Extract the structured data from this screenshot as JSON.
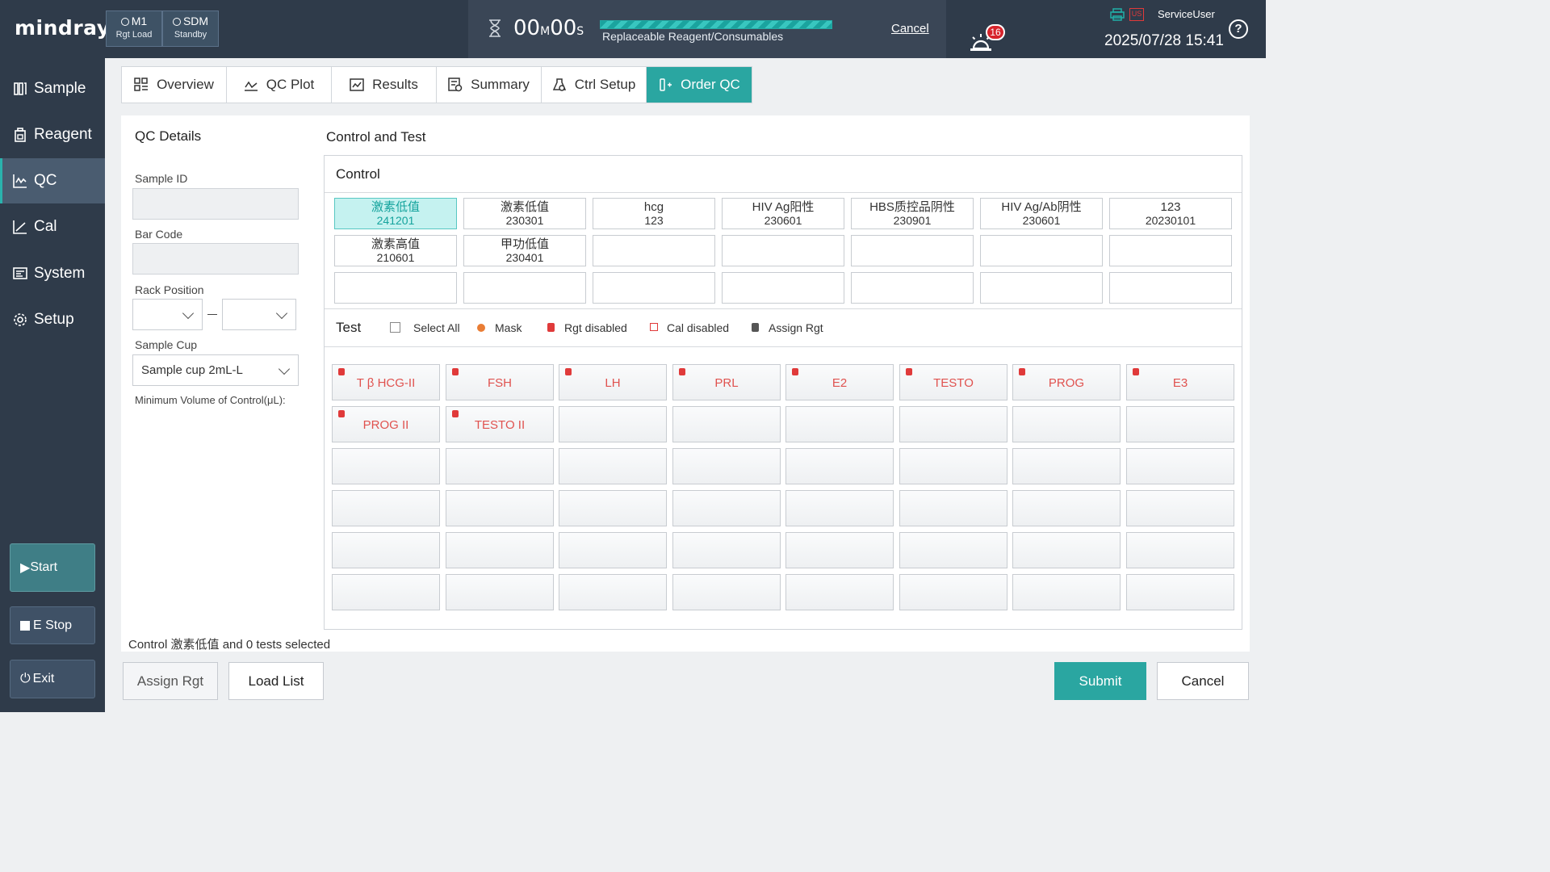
{
  "header": {
    "logo": "mindray",
    "modules": [
      {
        "name": "M1",
        "status": "Rgt Load"
      },
      {
        "name": "SDM",
        "status": "Standby"
      }
    ],
    "timer_min": "00",
    "timer_min_unit": "M",
    "timer_sec": "00",
    "timer_sec_unit": "S",
    "progress_percent": 100,
    "progress_label": "Replaceable Reagent/Consumables",
    "cancel_label": "Cancel",
    "alarm_count": "16",
    "us_label": "US",
    "user": "ServiceUser",
    "datetime": "2025/07/28 15:41",
    "help": "?"
  },
  "sidebar": {
    "items": [
      {
        "label": "Sample",
        "icon": "sample-icon"
      },
      {
        "label": "Reagent",
        "icon": "reagent-icon"
      },
      {
        "label": "QC",
        "icon": "qc-icon",
        "active": true
      },
      {
        "label": "Cal",
        "icon": "cal-icon"
      },
      {
        "label": "System",
        "icon": "system-icon"
      },
      {
        "label": "Setup",
        "icon": "setup-icon"
      }
    ],
    "start": "Start",
    "estop": "E Stop",
    "exit": "Exit"
  },
  "tabs": [
    {
      "label": "Overview",
      "icon": "overview-icon"
    },
    {
      "label": "QC Plot",
      "icon": "qc-plot-icon"
    },
    {
      "label": "Results",
      "icon": "results-icon"
    },
    {
      "label": "Summary",
      "icon": "summary-icon"
    },
    {
      "label": "Ctrl Setup",
      "icon": "ctrl-setup-icon"
    },
    {
      "label": "Order QC",
      "icon": "order-qc-icon",
      "active": true
    }
  ],
  "qc_details": {
    "title": "QC Details",
    "sample_id_label": "Sample ID",
    "sample_id_value": "",
    "bar_code_label": "Bar Code",
    "bar_code_value": "",
    "rack_position_label": "Rack Position",
    "rack_from": "",
    "rack_to": "",
    "sample_cup_label": "Sample Cup",
    "sample_cup_value": "Sample cup 2mL-L",
    "min_volume_label": "Minimum Volume of Control(μL):"
  },
  "control_test": {
    "title": "Control and Test",
    "control_header": "Control",
    "controls": [
      {
        "name": "激素低值",
        "lot": "241201",
        "selected": true
      },
      {
        "name": "激素低值",
        "lot": "230301"
      },
      {
        "name": "hcg",
        "lot": "123"
      },
      {
        "name": "HIV Ag阳性",
        "lot": "230601"
      },
      {
        "name": "HBS质控品阴性",
        "lot": "230901"
      },
      {
        "name": "HIV Ag/Ab阴性",
        "lot": "230601"
      },
      {
        "name": "123",
        "lot": "20230101"
      },
      {
        "name": "激素高值",
        "lot": "210601"
      },
      {
        "name": "甲功低值",
        "lot": "230401"
      }
    ],
    "test_header": "Test",
    "select_all": "Select All",
    "legend": {
      "mask": "Mask",
      "rgt_disabled": "Rgt disabled",
      "cal_disabled": "Cal disabled",
      "assign_rgt": "Assign Rgt"
    },
    "tests": [
      "T β HCG-II",
      "FSH",
      "LH",
      "PRL",
      "E2",
      "TESTO",
      "PROG",
      "E3",
      "PROG II",
      "TESTO II"
    ]
  },
  "status": "Control 激素低值 and  0 tests selected",
  "buttons": {
    "assign_rgt": "Assign Rgt",
    "load_list": "Load List",
    "submit": "Submit",
    "cancel": "Cancel"
  },
  "colors": {
    "accent": "#2aa6a1",
    "sidebar_bg": "#2f3b4a",
    "disabled_red": "#e0524f"
  }
}
